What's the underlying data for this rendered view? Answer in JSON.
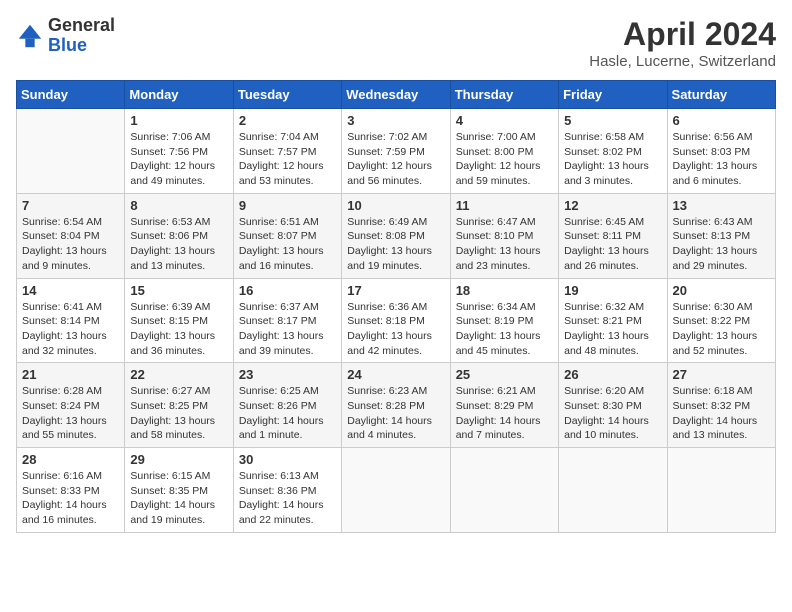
{
  "header": {
    "logo_general": "General",
    "logo_blue": "Blue",
    "month_year": "April 2024",
    "location": "Hasle, Lucerne, Switzerland"
  },
  "weekdays": [
    "Sunday",
    "Monday",
    "Tuesday",
    "Wednesday",
    "Thursday",
    "Friday",
    "Saturday"
  ],
  "weeks": [
    [
      {
        "day": "",
        "info": ""
      },
      {
        "day": "1",
        "info": "Sunrise: 7:06 AM\nSunset: 7:56 PM\nDaylight: 12 hours\nand 49 minutes."
      },
      {
        "day": "2",
        "info": "Sunrise: 7:04 AM\nSunset: 7:57 PM\nDaylight: 12 hours\nand 53 minutes."
      },
      {
        "day": "3",
        "info": "Sunrise: 7:02 AM\nSunset: 7:59 PM\nDaylight: 12 hours\nand 56 minutes."
      },
      {
        "day": "4",
        "info": "Sunrise: 7:00 AM\nSunset: 8:00 PM\nDaylight: 12 hours\nand 59 minutes."
      },
      {
        "day": "5",
        "info": "Sunrise: 6:58 AM\nSunset: 8:02 PM\nDaylight: 13 hours\nand 3 minutes."
      },
      {
        "day": "6",
        "info": "Sunrise: 6:56 AM\nSunset: 8:03 PM\nDaylight: 13 hours\nand 6 minutes."
      }
    ],
    [
      {
        "day": "7",
        "info": "Sunrise: 6:54 AM\nSunset: 8:04 PM\nDaylight: 13 hours\nand 9 minutes."
      },
      {
        "day": "8",
        "info": "Sunrise: 6:53 AM\nSunset: 8:06 PM\nDaylight: 13 hours\nand 13 minutes."
      },
      {
        "day": "9",
        "info": "Sunrise: 6:51 AM\nSunset: 8:07 PM\nDaylight: 13 hours\nand 16 minutes."
      },
      {
        "day": "10",
        "info": "Sunrise: 6:49 AM\nSunset: 8:08 PM\nDaylight: 13 hours\nand 19 minutes."
      },
      {
        "day": "11",
        "info": "Sunrise: 6:47 AM\nSunset: 8:10 PM\nDaylight: 13 hours\nand 23 minutes."
      },
      {
        "day": "12",
        "info": "Sunrise: 6:45 AM\nSunset: 8:11 PM\nDaylight: 13 hours\nand 26 minutes."
      },
      {
        "day": "13",
        "info": "Sunrise: 6:43 AM\nSunset: 8:13 PM\nDaylight: 13 hours\nand 29 minutes."
      }
    ],
    [
      {
        "day": "14",
        "info": "Sunrise: 6:41 AM\nSunset: 8:14 PM\nDaylight: 13 hours\nand 32 minutes."
      },
      {
        "day": "15",
        "info": "Sunrise: 6:39 AM\nSunset: 8:15 PM\nDaylight: 13 hours\nand 36 minutes."
      },
      {
        "day": "16",
        "info": "Sunrise: 6:37 AM\nSunset: 8:17 PM\nDaylight: 13 hours\nand 39 minutes."
      },
      {
        "day": "17",
        "info": "Sunrise: 6:36 AM\nSunset: 8:18 PM\nDaylight: 13 hours\nand 42 minutes."
      },
      {
        "day": "18",
        "info": "Sunrise: 6:34 AM\nSunset: 8:19 PM\nDaylight: 13 hours\nand 45 minutes."
      },
      {
        "day": "19",
        "info": "Sunrise: 6:32 AM\nSunset: 8:21 PM\nDaylight: 13 hours\nand 48 minutes."
      },
      {
        "day": "20",
        "info": "Sunrise: 6:30 AM\nSunset: 8:22 PM\nDaylight: 13 hours\nand 52 minutes."
      }
    ],
    [
      {
        "day": "21",
        "info": "Sunrise: 6:28 AM\nSunset: 8:24 PM\nDaylight: 13 hours\nand 55 minutes."
      },
      {
        "day": "22",
        "info": "Sunrise: 6:27 AM\nSunset: 8:25 PM\nDaylight: 13 hours\nand 58 minutes."
      },
      {
        "day": "23",
        "info": "Sunrise: 6:25 AM\nSunset: 8:26 PM\nDaylight: 14 hours\nand 1 minute."
      },
      {
        "day": "24",
        "info": "Sunrise: 6:23 AM\nSunset: 8:28 PM\nDaylight: 14 hours\nand 4 minutes."
      },
      {
        "day": "25",
        "info": "Sunrise: 6:21 AM\nSunset: 8:29 PM\nDaylight: 14 hours\nand 7 minutes."
      },
      {
        "day": "26",
        "info": "Sunrise: 6:20 AM\nSunset: 8:30 PM\nDaylight: 14 hours\nand 10 minutes."
      },
      {
        "day": "27",
        "info": "Sunrise: 6:18 AM\nSunset: 8:32 PM\nDaylight: 14 hours\nand 13 minutes."
      }
    ],
    [
      {
        "day": "28",
        "info": "Sunrise: 6:16 AM\nSunset: 8:33 PM\nDaylight: 14 hours\nand 16 minutes."
      },
      {
        "day": "29",
        "info": "Sunrise: 6:15 AM\nSunset: 8:35 PM\nDaylight: 14 hours\nand 19 minutes."
      },
      {
        "day": "30",
        "info": "Sunrise: 6:13 AM\nSunset: 8:36 PM\nDaylight: 14 hours\nand 22 minutes."
      },
      {
        "day": "",
        "info": ""
      },
      {
        "day": "",
        "info": ""
      },
      {
        "day": "",
        "info": ""
      },
      {
        "day": "",
        "info": ""
      }
    ]
  ]
}
